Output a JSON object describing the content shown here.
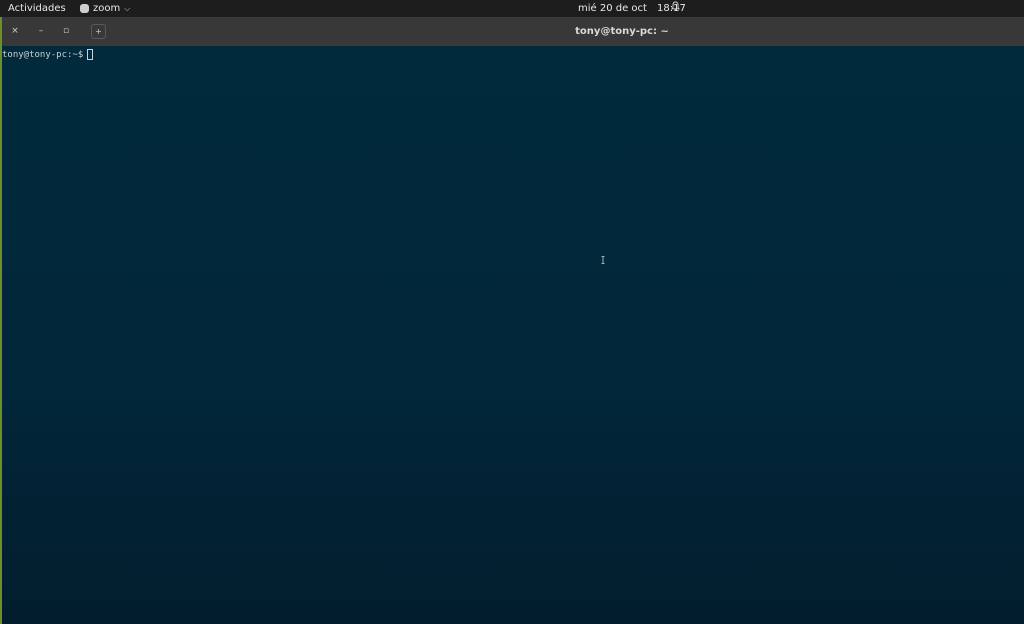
{
  "topbar": {
    "activities_label": "Actividades",
    "app_name": "zoom",
    "app_chevron": "⌵",
    "date": "mié 20 de oct",
    "time": "18:17",
    "bell_icon": "bell-icon"
  },
  "window": {
    "title": "tony@tony-pc: ~",
    "close_glyph": "×",
    "minimize_glyph": "–",
    "maximize_glyph": "▫",
    "new_tab_glyph": "+"
  },
  "terminal": {
    "prompt": "tony@tony-pc:~$",
    "input": ""
  },
  "colors": {
    "terminal_bg": "#012a3c",
    "topbar_bg": "#1d1d1d",
    "headerbar_bg": "#383838",
    "window_border": "#6c8f2a"
  }
}
